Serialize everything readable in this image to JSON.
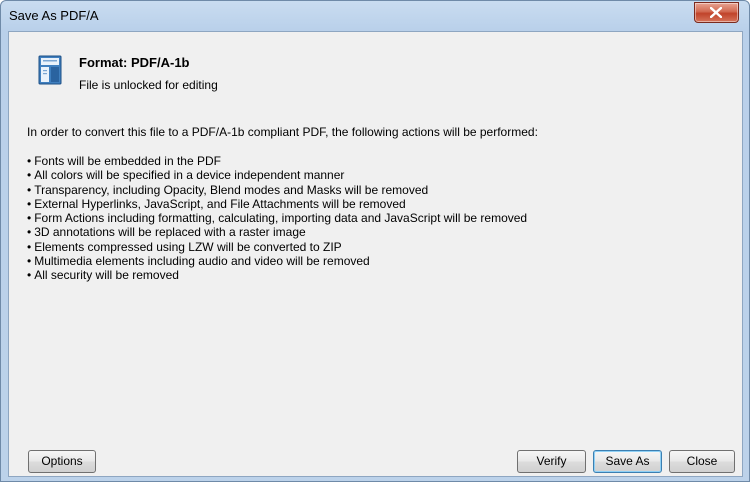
{
  "window": {
    "title": "Save As PDF/A",
    "close_label": "close"
  },
  "header": {
    "icon": "pdf-document-icon",
    "format": "Format: PDF/A-1b",
    "status": "File is unlocked for editing"
  },
  "body": {
    "intro": "In order to convert this file to a PDF/A-1b compliant PDF, the following actions will be performed:",
    "actions": [
      "Fonts will be embedded in the PDF",
      "All colors will be specified in a device independent manner",
      "Transparency, including Opacity, Blend modes and Masks will be removed",
      "External Hyperlinks, JavaScript, and File Attachments will be removed",
      "Form Actions including formatting, calculating, importing data and JavaScript will be removed",
      "3D annotations will be replaced with a raster image",
      "Elements compressed using LZW will be converted to ZIP",
      "Multimedia elements including audio and video will be removed",
      "All security will be removed"
    ]
  },
  "buttons": {
    "options": "Options",
    "verify": "Verify",
    "save_as": "Save As",
    "close": "Close"
  },
  "colors": {
    "title_bar": "#bcd2ea",
    "client_bg": "#f0f0f0",
    "close_button": "#c0432a",
    "default_button_border": "#3c7fb1"
  }
}
